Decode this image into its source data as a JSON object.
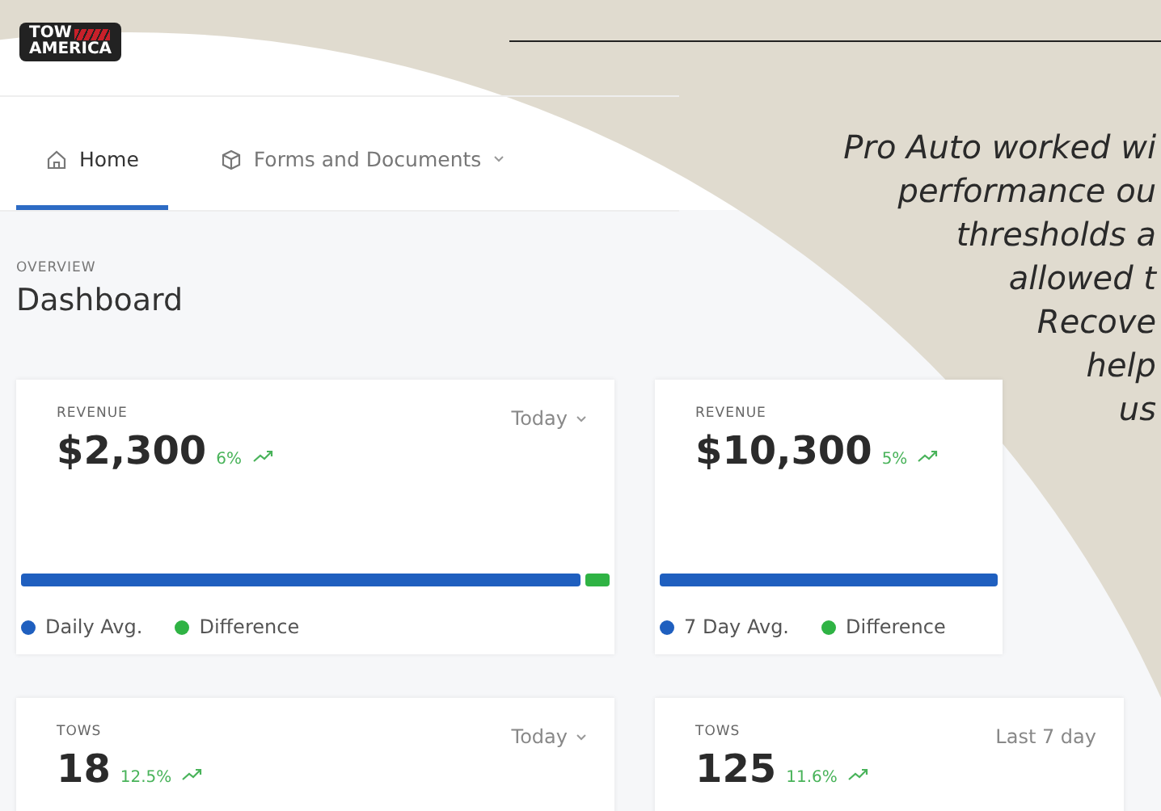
{
  "logo": {
    "line_1": "TOW",
    "line_2": "AMERICA"
  },
  "tabs": [
    {
      "label": "Home",
      "selected": true,
      "dropdown": false
    },
    {
      "label": "Forms and Documents",
      "selected": false,
      "dropdown": true
    }
  ],
  "overview": {
    "eyebrow": "OVERVIEW",
    "title": "Dashboard"
  },
  "cards": [
    {
      "title": "REVENUE",
      "range": "Today",
      "dropdown": true,
      "value": "$2,300",
      "change": "6%",
      "level": 0.95,
      "segments": [
        {
          "label": "Daily Avg.",
          "color": "#1f5fbf"
        },
        {
          "label": "Difference",
          "color": "#2fb344"
        }
      ]
    },
    {
      "title": "REVENUE",
      "value": "$10,300",
      "change": "5%",
      "level": 1.0,
      "segments": [
        {
          "label": "7 Day Avg.",
          "color": "#1f5fbf"
        },
        {
          "label": "Difference",
          "color": "#2fb344"
        }
      ]
    },
    {
      "title": "TOWS",
      "range": "Today",
      "dropdown": true,
      "value": "18",
      "change": "12.5%"
    },
    {
      "title": "TOWS",
      "range": "Last 7 day",
      "dropdown": false,
      "value": "125",
      "change": "11.6%"
    }
  ],
  "quote_lines": [
    "Pro Auto worked wi",
    "performance ou",
    "thresholds a",
    "allowed t",
    "Recove",
    "help",
    "us"
  ]
}
